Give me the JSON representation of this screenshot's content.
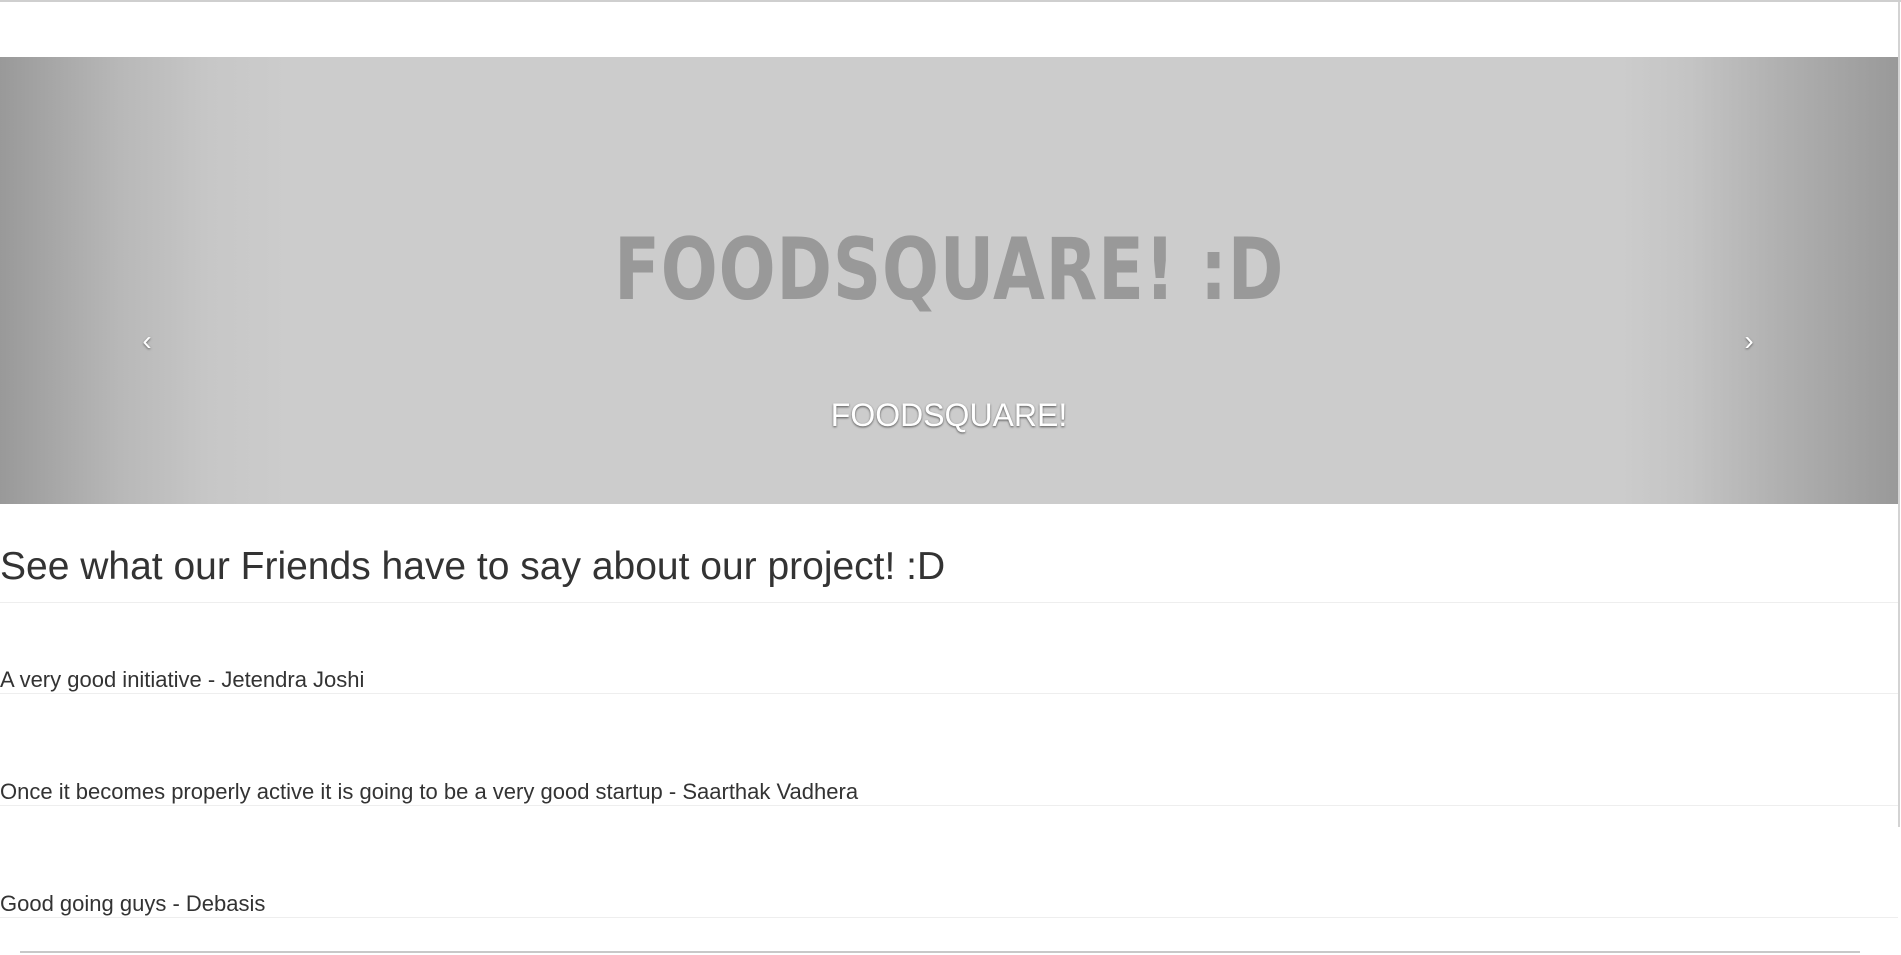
{
  "carousel": {
    "slide_image_text": "FOODSQUARE! :D",
    "caption": "FOODSQUARE!",
    "prev_icon": "‹",
    "next_icon": "›"
  },
  "testimonials": {
    "heading": "See what our Friends have to say about our project! :D",
    "items": [
      "A very good initiative - Jetendra Joshi",
      "Once it becomes properly active it is going to be a very good startup - Saarthak Vadhera",
      "Good going guys - Debasis"
    ]
  }
}
